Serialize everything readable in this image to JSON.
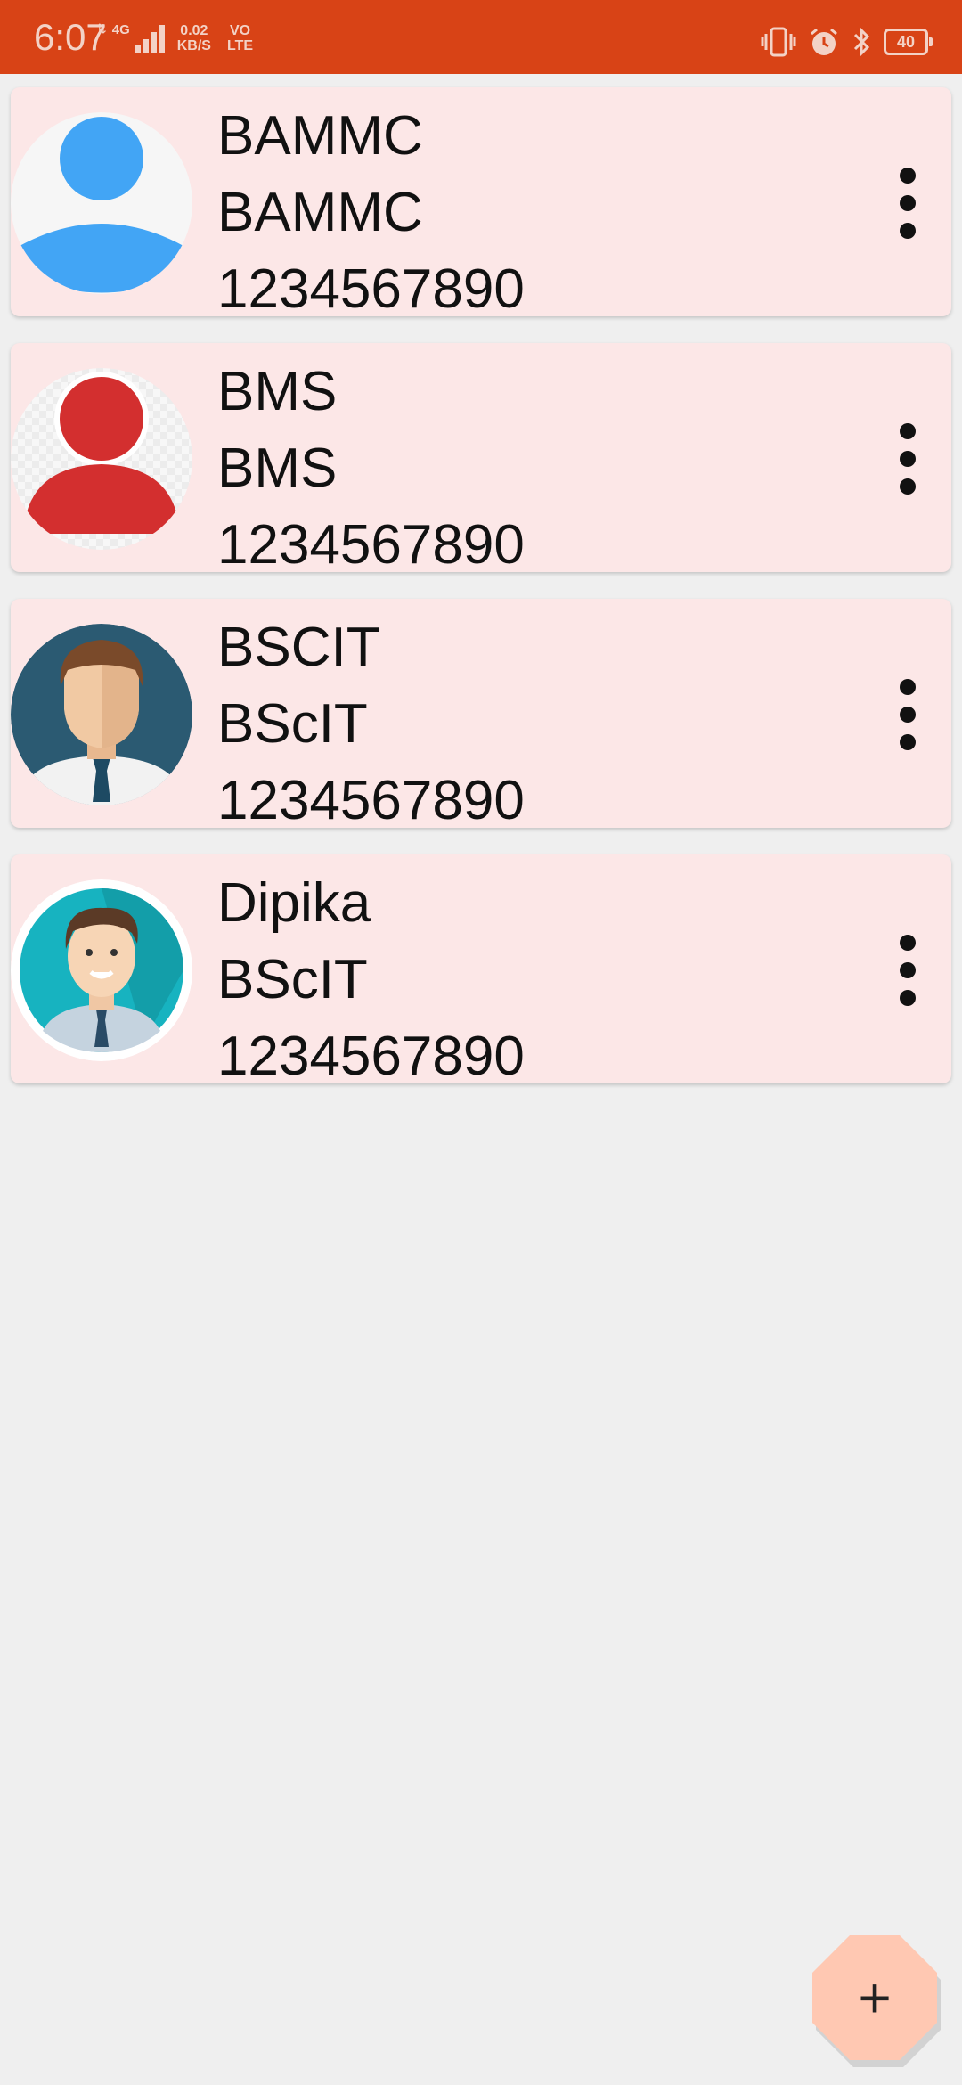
{
  "status_bar": {
    "time": "6:07",
    "network": "4G",
    "speed_value": "0.02",
    "speed_unit": "KB/S",
    "volte_top": "VO",
    "volte_bottom": "LTE",
    "battery": "40"
  },
  "contacts": [
    {
      "name": "BAMMC",
      "course": "BAMMC",
      "phone": "1234567890",
      "avatar": "avatar-blue-person-icon"
    },
    {
      "name": "BMS",
      "course": "BMS",
      "phone": "1234567890",
      "avatar": "avatar-red-person-icon"
    },
    {
      "name": "BSCIT",
      "course": "BScIT",
      "phone": "1234567890",
      "avatar": "avatar-man-navy-icon"
    },
    {
      "name": "Dipika",
      "course": "BScIT",
      "phone": "1234567890",
      "avatar": "avatar-man-teal-icon"
    }
  ],
  "fab": {
    "label": "+",
    "icon": "add-icon"
  },
  "colors": {
    "status_bar": "#d84316",
    "card": "#fce7e7",
    "background": "#efefef",
    "fab": "#ffc8b2"
  }
}
